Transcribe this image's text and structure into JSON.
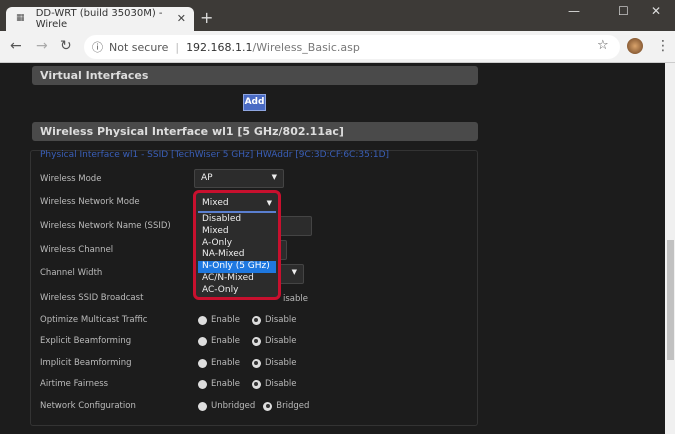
{
  "browser": {
    "tab_title": "DD-WRT (build 35030M) - Wirele",
    "not_secure": "Not secure",
    "url_host": "192.168.1.1",
    "url_path": "/Wireless_Basic.asp"
  },
  "virtual": {
    "header": "Virtual Interfaces",
    "add_label": "Add"
  },
  "physical": {
    "header": "Wireless Physical Interface wl1 [5 GHz/802.11ac]",
    "subtitle": "Physical Interface wl1 - SSID [TechWiser 5 GHz] HWAddr [9C:3D:CF:6C:35:1D]"
  },
  "fields": {
    "wireless_mode": {
      "label": "Wireless Mode",
      "value": "AP"
    },
    "network_mode": {
      "label": "Wireless Network Mode",
      "value": "Mixed",
      "options": [
        "Disabled",
        "Mixed",
        "A-Only",
        "NA-Mixed",
        "N-Only (5 GHz)",
        "AC/N-Mixed",
        "AC-Only"
      ],
      "highlighted": "N-Only (5 GHz)"
    },
    "ssid": {
      "label": "Wireless Network Name (SSID)"
    },
    "channel": {
      "label": "Wireless Channel"
    },
    "channel_width": {
      "label": "Channel Width"
    },
    "ssid_broadcast": {
      "label": "Wireless SSID Broadcast",
      "opt2": "isable"
    }
  },
  "radio_rows": [
    {
      "label": "Optimize Multicast Traffic",
      "a": "Enable",
      "b": "Disable"
    },
    {
      "label": "Explicit Beamforming",
      "a": "Enable",
      "b": "Disable"
    },
    {
      "label": "Implicit Beamforming",
      "a": "Enable",
      "b": "Disable"
    },
    {
      "label": "Airtime Fairness",
      "a": "Enable",
      "b": "Disable"
    },
    {
      "label": "Network Configuration",
      "a": "Unbridged",
      "b": "Bridged"
    }
  ]
}
